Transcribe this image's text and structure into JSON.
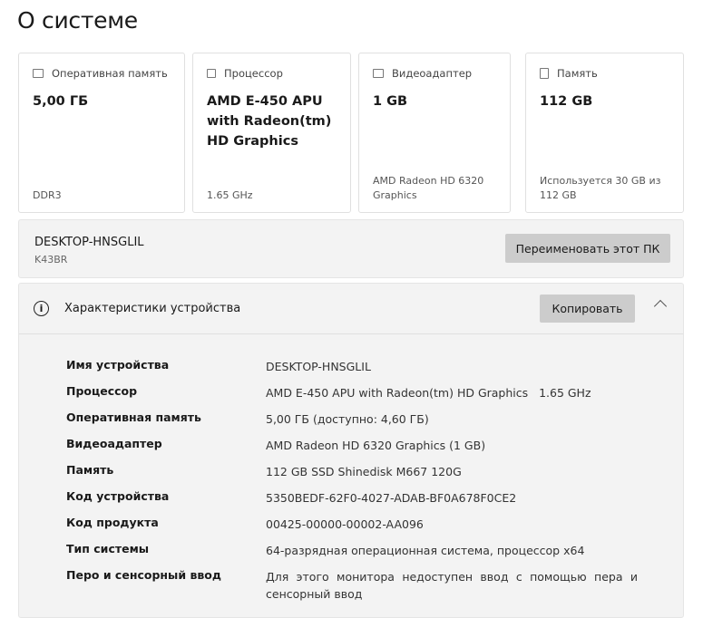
{
  "title": "О системе",
  "cards": [
    {
      "icon": "memory-icon",
      "label": "Оперативная память",
      "value": "5,00 ГБ",
      "sub": "DDR3"
    },
    {
      "icon": "processor-icon",
      "label": "Процессор",
      "value": "AMD E-450 APU with Radeon(tm) HD Graphics",
      "sub": "1.65 GHz"
    },
    {
      "icon": "display-adapter-icon",
      "label": "Видеоадаптер",
      "value": "1 GB",
      "sub": "AMD Radeon HD 6320 Graphics"
    },
    {
      "icon": "storage-icon",
      "label": "Память",
      "value": "112 GB",
      "sub": "Используется 30 GB из 112 GB"
    }
  ],
  "device": {
    "name": "DESKTOP-HNSGLIL",
    "model": "K43BR",
    "rename_label": "Переименовать этот ПК"
  },
  "specs": {
    "title": "Характеристики устройства",
    "copy_label": "Копировать",
    "rows": [
      {
        "label": "Имя устройства",
        "value": "DESKTOP-HNSGLIL"
      },
      {
        "label": "Процессор",
        "value": "AMD E-450 APU with Radeon(tm) HD Graphics   1.65 GHz"
      },
      {
        "label": "Оперативная память",
        "value": "5,00 ГБ (доступно: 4,60 ГБ)"
      },
      {
        "label": "Видеоадаптер",
        "value": "AMD Radeon HD 6320 Graphics (1 GB)"
      },
      {
        "label": "Память",
        "value": "112 GB SSD Shinedisk M667 120G"
      },
      {
        "label": "Код устройства",
        "value": "5350BEDF-62F0-4027-ADAB-BF0A678F0CE2"
      },
      {
        "label": "Код продукта",
        "value": "00425-00000-00002-AA096"
      },
      {
        "label": "Тип системы",
        "value": "64-разрядная операционная система, процессор x64"
      },
      {
        "label": "Перо и сенсорный ввод",
        "value": "Для этого монитора недоступен ввод с помощью пера и сенсорный ввод"
      }
    ]
  }
}
